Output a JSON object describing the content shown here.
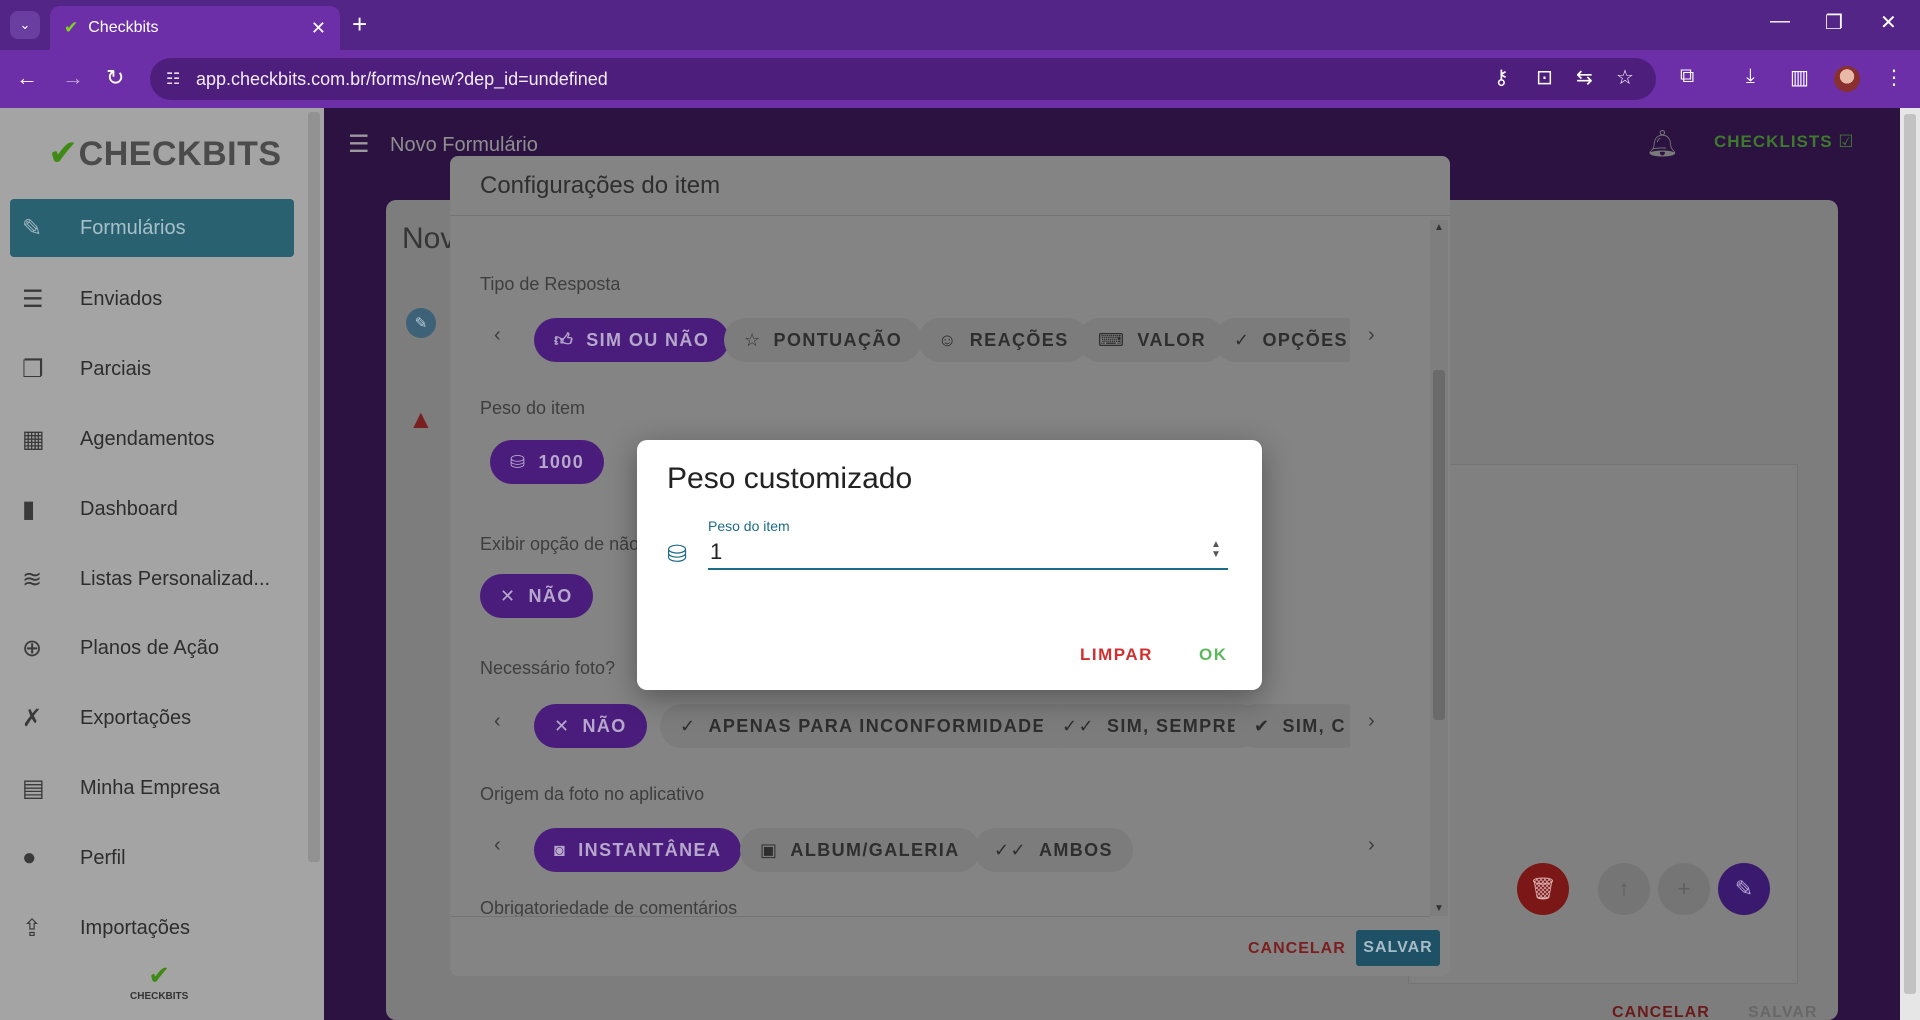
{
  "browser": {
    "tab_title": "Checkbits",
    "url": "app.checkbits.com.br/forms/new?dep_id=undefined"
  },
  "sidebar": {
    "logo_text": "CHECKBITS",
    "footer_text": "CHECKBITS",
    "items": [
      {
        "label": "Formulários",
        "icon": "forms-icon",
        "active": true
      },
      {
        "label": "Enviados",
        "icon": "sent-icon"
      },
      {
        "label": "Parciais",
        "icon": "partial-icon"
      },
      {
        "label": "Agendamentos",
        "icon": "calendar-icon"
      },
      {
        "label": "Dashboard",
        "icon": "bar-chart-icon"
      },
      {
        "label": "Listas Personalizad...",
        "icon": "database-icon"
      },
      {
        "label": "Planos de Ação",
        "icon": "target-icon"
      },
      {
        "label": "Exportações",
        "icon": "excel-icon"
      },
      {
        "label": "Minha Empresa",
        "icon": "building-icon"
      },
      {
        "label": "Perfil",
        "icon": "person-icon"
      },
      {
        "label": "Importações",
        "icon": "import-icon"
      }
    ]
  },
  "topbar": {
    "title": "Novo Formulário",
    "checklists_label": "CHECKLISTS"
  },
  "background": {
    "card_title": "Nov",
    "cancel_label": "CANCELAR",
    "save_label": "SALVAR"
  },
  "item_modal": {
    "title": "Configurações do item",
    "response_type": {
      "label": "Tipo de Resposta",
      "options": [
        "SIM OU NÃO",
        "PONTUAÇÃO",
        "REAÇÕES",
        "VALOR",
        "OPÇÕES"
      ]
    },
    "weight": {
      "label": "Peso do item",
      "value": "1000"
    },
    "non_applicable": {
      "label": "Exibir opção de não",
      "value": "NÃO"
    },
    "photo_required": {
      "label": "Necessário foto?",
      "options": [
        "NÃO",
        "APENAS PARA INCONFORMIDADES",
        "SIM, SEMPRE",
        "SIM, C"
      ]
    },
    "photo_origin": {
      "label": "Origem da foto no aplicativo",
      "options": [
        "INSTANTÂNEA",
        "ALBUM/GALERIA",
        "AMBOS"
      ]
    },
    "next_section_label": "Obrigatoriedade de comentários",
    "cancel_label": "CANCELAR",
    "save_label": "SALVAR"
  },
  "weight_dialog": {
    "title": "Peso customizado",
    "field_label": "Peso do item",
    "field_value": "1",
    "clear_label": "LIMPAR",
    "ok_label": "OK"
  }
}
